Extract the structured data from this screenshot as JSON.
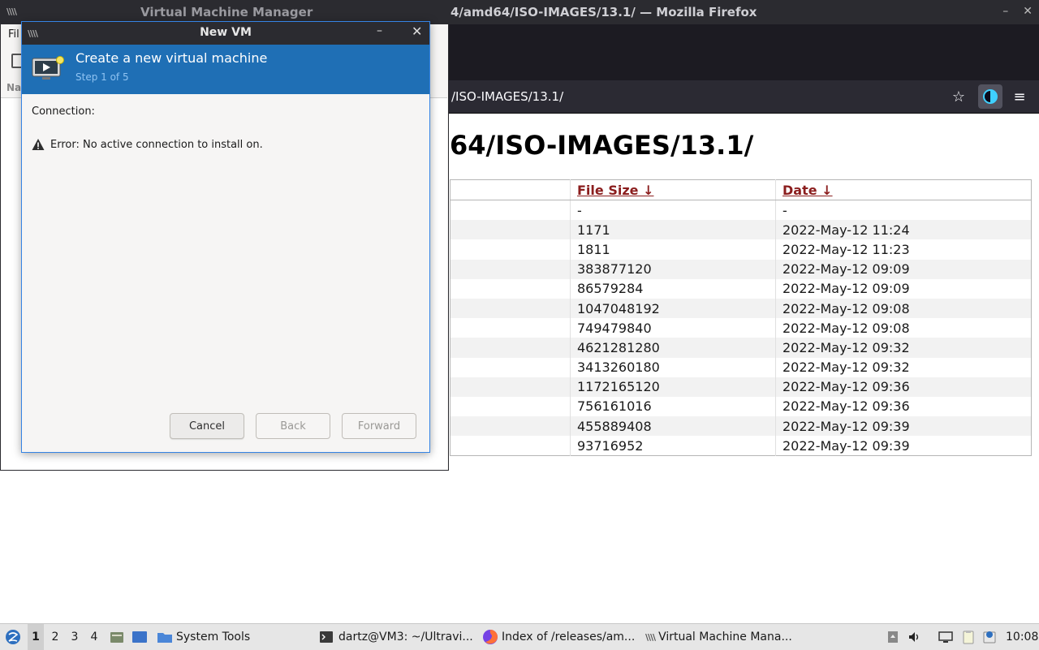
{
  "firefox": {
    "window_title": "4/amd64/ISO-IMAGES/13.1/ — Mozilla Firefox",
    "url": "/ISO-IMAGES/13.1/",
    "page_heading": "64/ISO-IMAGES/13.1/",
    "columns": {
      "size": "File Size  ↓",
      "date": "Date  ↓"
    },
    "rows": [
      {
        "size": "-",
        "date": "-"
      },
      {
        "size": "1171",
        "date": "2022-May-12 11:24"
      },
      {
        "size": "1811",
        "date": "2022-May-12 11:23"
      },
      {
        "size": "383877120",
        "date": "2022-May-12 09:09"
      },
      {
        "size": "86579284",
        "date": "2022-May-12 09:09"
      },
      {
        "size": "1047048192",
        "date": "2022-May-12 09:08"
      },
      {
        "size": "749479840",
        "date": "2022-May-12 09:08"
      },
      {
        "size": "4621281280",
        "date": "2022-May-12 09:32"
      },
      {
        "size": "3413260180",
        "date": "2022-May-12 09:32"
      },
      {
        "size": "1172165120",
        "date": "2022-May-12 09:36"
      },
      {
        "size": "756161016",
        "date": "2022-May-12 09:36"
      },
      {
        "size": "455889408",
        "date": "2022-May-12 09:39"
      },
      {
        "size": "93716952",
        "date": "2022-May-12 09:39"
      }
    ],
    "icons": [
      "bookmark-star-icon",
      "extension-icon",
      "hamburger-menu-icon"
    ]
  },
  "vmm": {
    "window_title": "Virtual Machine Manager",
    "menu_partial": "Fil",
    "column_partial": "Na"
  },
  "dialog": {
    "title": "New VM",
    "header_title": "Create a new virtual machine",
    "header_subtitle": "Step 1 of 5",
    "connection_label": "Connection:",
    "error_text": "Error: No active connection to install on.",
    "buttons": {
      "cancel": "Cancel",
      "back": "Back",
      "forward": "Forward"
    }
  },
  "taskbar": {
    "workspaces": [
      "1",
      "2",
      "3",
      "4"
    ],
    "system_tools": "System Tools",
    "tasks": {
      "terminal": "dartz@VM3: ~/Ultravi...",
      "firefox": "Index of /releases/am...",
      "vmm": "Virtual Machine Mana..."
    },
    "clock": "10:08"
  },
  "colors": {
    "dialog_header": "#1f6fb5",
    "link": "#8b1e1e",
    "titlebar": "#2b2b30",
    "taskbar": "#e6e6e6"
  }
}
